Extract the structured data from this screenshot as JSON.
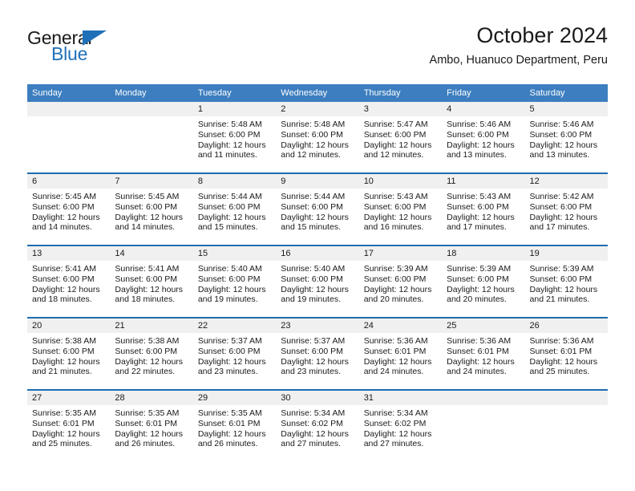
{
  "brand": {
    "name_top": "General",
    "name_bottom": "Blue",
    "triangle_icon": "triangle-icon",
    "accent_color": "#1f70b8"
  },
  "header": {
    "title": "October 2024",
    "subtitle": "Ambo, Huanuco Department, Peru"
  },
  "theme": {
    "header_row_bg": "#3c7ebf",
    "row_divider": "#1f6cb0",
    "date_band_bg": "#f0f0f0",
    "text": "#1a1a1a"
  },
  "calendar": {
    "weekday_headers": [
      "Sunday",
      "Monday",
      "Tuesday",
      "Wednesday",
      "Thursday",
      "Friday",
      "Saturday"
    ],
    "labels": {
      "sunrise_prefix": "Sunrise:",
      "sunset_prefix": "Sunset:",
      "daylight_prefix": "Daylight:"
    },
    "weeks": [
      [
        {
          "day": "",
          "empty": true
        },
        {
          "day": "",
          "empty": true
        },
        {
          "day": "1",
          "sunrise": "Sunrise: 5:48 AM",
          "sunset": "Sunset: 6:00 PM",
          "daylight": "Daylight: 12 hours and 11 minutes."
        },
        {
          "day": "2",
          "sunrise": "Sunrise: 5:48 AM",
          "sunset": "Sunset: 6:00 PM",
          "daylight": "Daylight: 12 hours and 12 minutes."
        },
        {
          "day": "3",
          "sunrise": "Sunrise: 5:47 AM",
          "sunset": "Sunset: 6:00 PM",
          "daylight": "Daylight: 12 hours and 12 minutes."
        },
        {
          "day": "4",
          "sunrise": "Sunrise: 5:46 AM",
          "sunset": "Sunset: 6:00 PM",
          "daylight": "Daylight: 12 hours and 13 minutes."
        },
        {
          "day": "5",
          "sunrise": "Sunrise: 5:46 AM",
          "sunset": "Sunset: 6:00 PM",
          "daylight": "Daylight: 12 hours and 13 minutes."
        }
      ],
      [
        {
          "day": "6",
          "sunrise": "Sunrise: 5:45 AM",
          "sunset": "Sunset: 6:00 PM",
          "daylight": "Daylight: 12 hours and 14 minutes."
        },
        {
          "day": "7",
          "sunrise": "Sunrise: 5:45 AM",
          "sunset": "Sunset: 6:00 PM",
          "daylight": "Daylight: 12 hours and 14 minutes."
        },
        {
          "day": "8",
          "sunrise": "Sunrise: 5:44 AM",
          "sunset": "Sunset: 6:00 PM",
          "daylight": "Daylight: 12 hours and 15 minutes."
        },
        {
          "day": "9",
          "sunrise": "Sunrise: 5:44 AM",
          "sunset": "Sunset: 6:00 PM",
          "daylight": "Daylight: 12 hours and 15 minutes."
        },
        {
          "day": "10",
          "sunrise": "Sunrise: 5:43 AM",
          "sunset": "Sunset: 6:00 PM",
          "daylight": "Daylight: 12 hours and 16 minutes."
        },
        {
          "day": "11",
          "sunrise": "Sunrise: 5:43 AM",
          "sunset": "Sunset: 6:00 PM",
          "daylight": "Daylight: 12 hours and 17 minutes."
        },
        {
          "day": "12",
          "sunrise": "Sunrise: 5:42 AM",
          "sunset": "Sunset: 6:00 PM",
          "daylight": "Daylight: 12 hours and 17 minutes."
        }
      ],
      [
        {
          "day": "13",
          "sunrise": "Sunrise: 5:41 AM",
          "sunset": "Sunset: 6:00 PM",
          "daylight": "Daylight: 12 hours and 18 minutes."
        },
        {
          "day": "14",
          "sunrise": "Sunrise: 5:41 AM",
          "sunset": "Sunset: 6:00 PM",
          "daylight": "Daylight: 12 hours and 18 minutes."
        },
        {
          "day": "15",
          "sunrise": "Sunrise: 5:40 AM",
          "sunset": "Sunset: 6:00 PM",
          "daylight": "Daylight: 12 hours and 19 minutes."
        },
        {
          "day": "16",
          "sunrise": "Sunrise: 5:40 AM",
          "sunset": "Sunset: 6:00 PM",
          "daylight": "Daylight: 12 hours and 19 minutes."
        },
        {
          "day": "17",
          "sunrise": "Sunrise: 5:39 AM",
          "sunset": "Sunset: 6:00 PM",
          "daylight": "Daylight: 12 hours and 20 minutes."
        },
        {
          "day": "18",
          "sunrise": "Sunrise: 5:39 AM",
          "sunset": "Sunset: 6:00 PM",
          "daylight": "Daylight: 12 hours and 20 minutes."
        },
        {
          "day": "19",
          "sunrise": "Sunrise: 5:39 AM",
          "sunset": "Sunset: 6:00 PM",
          "daylight": "Daylight: 12 hours and 21 minutes."
        }
      ],
      [
        {
          "day": "20",
          "sunrise": "Sunrise: 5:38 AM",
          "sunset": "Sunset: 6:00 PM",
          "daylight": "Daylight: 12 hours and 21 minutes."
        },
        {
          "day": "21",
          "sunrise": "Sunrise: 5:38 AM",
          "sunset": "Sunset: 6:00 PM",
          "daylight": "Daylight: 12 hours and 22 minutes."
        },
        {
          "day": "22",
          "sunrise": "Sunrise: 5:37 AM",
          "sunset": "Sunset: 6:00 PM",
          "daylight": "Daylight: 12 hours and 23 minutes."
        },
        {
          "day": "23",
          "sunrise": "Sunrise: 5:37 AM",
          "sunset": "Sunset: 6:00 PM",
          "daylight": "Daylight: 12 hours and 23 minutes."
        },
        {
          "day": "24",
          "sunrise": "Sunrise: 5:36 AM",
          "sunset": "Sunset: 6:01 PM",
          "daylight": "Daylight: 12 hours and 24 minutes."
        },
        {
          "day": "25",
          "sunrise": "Sunrise: 5:36 AM",
          "sunset": "Sunset: 6:01 PM",
          "daylight": "Daylight: 12 hours and 24 minutes."
        },
        {
          "day": "26",
          "sunrise": "Sunrise: 5:36 AM",
          "sunset": "Sunset: 6:01 PM",
          "daylight": "Daylight: 12 hours and 25 minutes."
        }
      ],
      [
        {
          "day": "27",
          "sunrise": "Sunrise: 5:35 AM",
          "sunset": "Sunset: 6:01 PM",
          "daylight": "Daylight: 12 hours and 25 minutes."
        },
        {
          "day": "28",
          "sunrise": "Sunrise: 5:35 AM",
          "sunset": "Sunset: 6:01 PM",
          "daylight": "Daylight: 12 hours and 26 minutes."
        },
        {
          "day": "29",
          "sunrise": "Sunrise: 5:35 AM",
          "sunset": "Sunset: 6:01 PM",
          "daylight": "Daylight: 12 hours and 26 minutes."
        },
        {
          "day": "30",
          "sunrise": "Sunrise: 5:34 AM",
          "sunset": "Sunset: 6:02 PM",
          "daylight": "Daylight: 12 hours and 27 minutes."
        },
        {
          "day": "31",
          "sunrise": "Sunrise: 5:34 AM",
          "sunset": "Sunset: 6:02 PM",
          "daylight": "Daylight: 12 hours and 27 minutes."
        },
        {
          "day": "",
          "empty": true
        },
        {
          "day": "",
          "empty": true
        }
      ]
    ]
  }
}
